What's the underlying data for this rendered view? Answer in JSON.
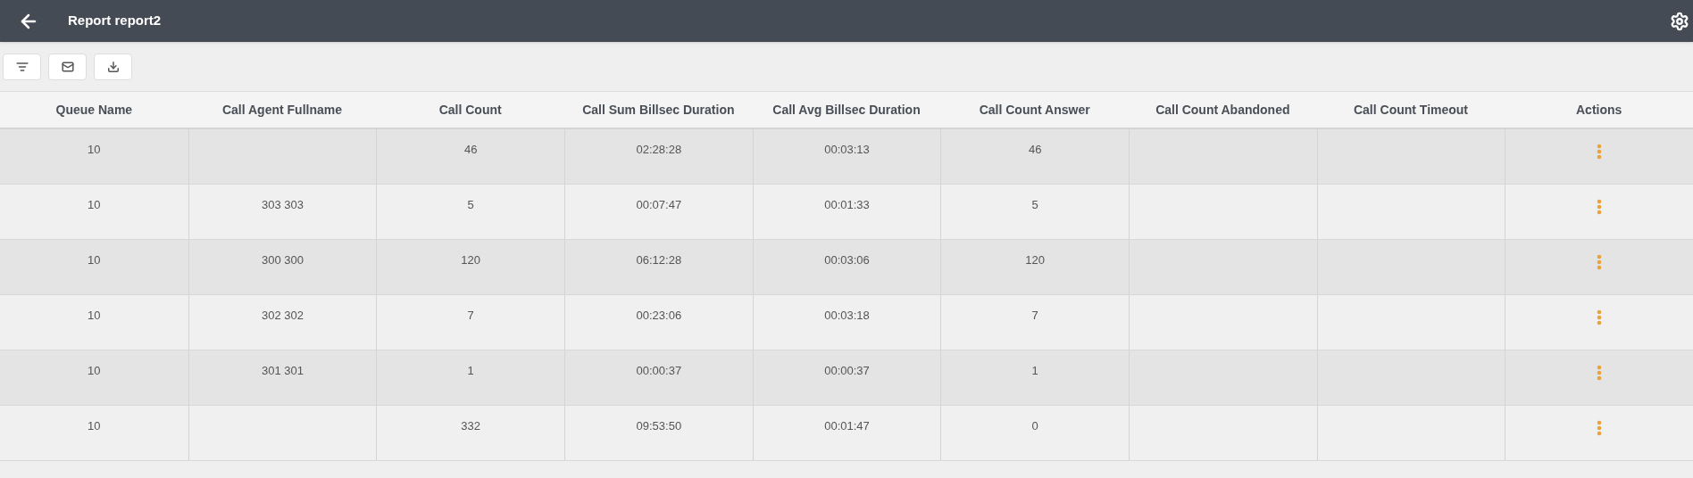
{
  "title": "Report report2",
  "toolbar": [
    {
      "kind": "filter"
    },
    {
      "kind": "email"
    },
    {
      "kind": "download"
    }
  ],
  "table": {
    "columns": [
      "Queue Name",
      "Call Agent Fullname",
      "Call Count",
      "Call Sum Billsec Duration",
      "Call Avg Billsec Duration",
      "Call Count Answer",
      "Call Count Abandoned",
      "Call Count Timeout",
      "Actions"
    ],
    "rows": [
      {
        "cells": [
          "10",
          "",
          "46",
          "02:28:28",
          "00:03:13",
          "46",
          "",
          ""
        ]
      },
      {
        "cells": [
          "10",
          "303 303",
          "5",
          "00:07:47",
          "00:01:33",
          "5",
          "",
          ""
        ]
      },
      {
        "cells": [
          "10",
          "300 300",
          "120",
          "06:12:28",
          "00:03:06",
          "120",
          "",
          ""
        ]
      },
      {
        "cells": [
          "10",
          "302 302",
          "7",
          "00:23:06",
          "00:03:18",
          "7",
          "",
          ""
        ]
      },
      {
        "cells": [
          "10",
          "301 301",
          "1",
          "00:00:37",
          "00:00:37",
          "1",
          "",
          ""
        ]
      },
      {
        "cells": [
          "10",
          "",
          "332",
          "09:53:50",
          "00:01:47",
          "0",
          "",
          ""
        ]
      }
    ]
  }
}
